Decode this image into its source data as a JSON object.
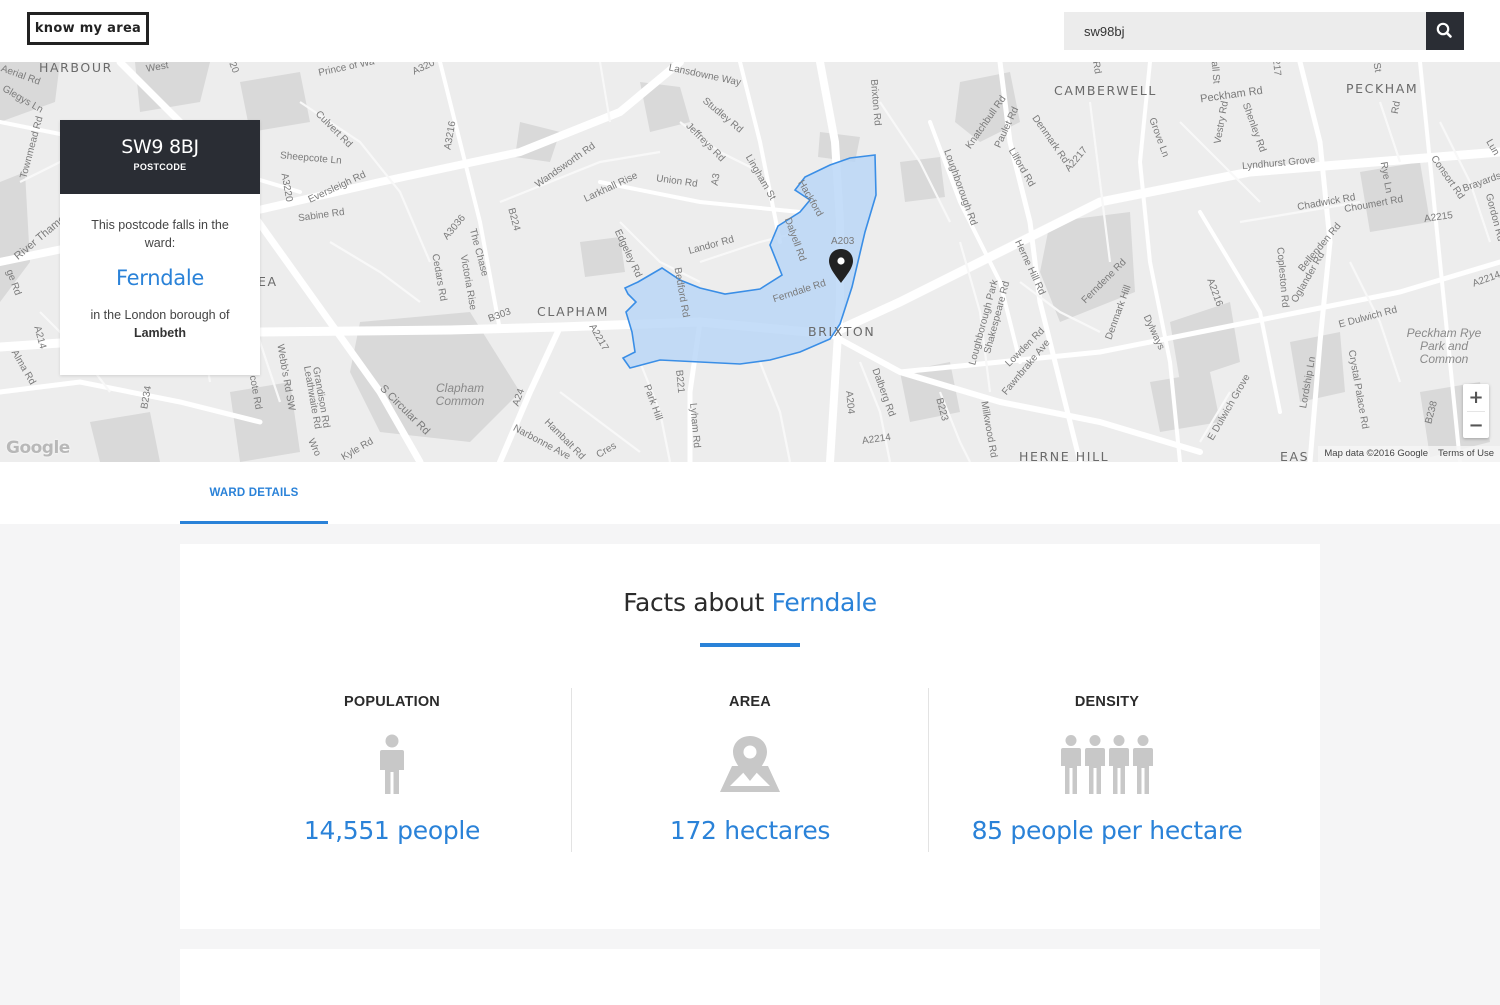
{
  "header": {
    "logo": "know my area",
    "search_value": "sw98bj",
    "search_icon": "search-icon"
  },
  "map": {
    "postcode": "SW9 8BJ",
    "postcode_label": "POSTCODE",
    "falls_in_text": "This postcode falls in the ward:",
    "ward": "Ferndale",
    "borough_text": "in the London borough of",
    "borough": "Lambeth",
    "zoom_in": "+",
    "zoom_out": "−",
    "google": "Google",
    "attribution": "Map data ©2016 Google",
    "terms": "Terms of Use",
    "pin_icon": "map-pin-icon",
    "ward_fill": "#b6d4f6",
    "ward_stroke": "#3a8ee6",
    "area_labels": [
      "HARBOUR",
      "CLAPHAM",
      "BRIXTON",
      "CAMBERWELL",
      "PECKHAM",
      "HERNE HILL",
      "EA",
      "EAS"
    ],
    "park_labels": [
      "Clapham Common",
      "Peckham Rye Park and Common"
    ],
    "road_labels": [
      "Lansdowne Way",
      "Prince of Wa",
      "A320",
      "A3216",
      "Culvert Rd",
      "Sheepcote Ln",
      "Wandsworth Rd",
      "Studley Rd",
      "Jeffreys Rd",
      "Brixton Rd",
      "Union Rd",
      "Larkhall Rise",
      "Lingham St",
      "A3",
      "Dalyell Rd",
      "Landor Rd",
      "A203",
      "Ferndale Rd",
      "Bedford Rd",
      "Edgeley Rd",
      "A2217",
      "B303",
      "A3036",
      "B224",
      "The Chase",
      "Victoria Rise",
      "Cedars Rd",
      "A3220",
      "Eversleigh Rd",
      "Sabine Rd",
      "River Thames",
      "A214",
      "Webb's Rd SW",
      "Grandison Rd",
      "Leathwaite Rd",
      "S Circular Rd",
      "A24",
      "Park Hill",
      "B221",
      "Lyham Rd",
      "Hambalt Rd",
      "Narbonne Ave",
      "Kyle Rd",
      "B234",
      "A204",
      "Dalberg Rd",
      "A2214",
      "B223",
      "Milkwood Rd",
      "Loughborough Rd",
      "Loughborough Park",
      "Shakespeare Rd",
      "Herne Hill Rd",
      "Lowden Rd",
      "Fawnbrake Ave",
      "Ferndene Rd",
      "Denmark Hill",
      "Dylways",
      "A2216",
      "E Dulwich Grove",
      "Lordship Ln",
      "Crystal Palace Rd",
      "B238",
      "E Dulwich Rd",
      "Copleston Rd",
      "Oglander Rd",
      "Bellenden Rd",
      "Chadwick Rd",
      "Choumert Rd",
      "A2215",
      "Lyndhurst Grove",
      "Peckham Rd",
      "Vestry Rd",
      "Shenley Rd",
      "Consort Rd",
      "Brayards",
      "Gordon Rd",
      "Rye Ln",
      "Grove Ln",
      "Denmark Rd",
      "Knatchbull Rd",
      "Paulet Rd",
      "Lilford Rd",
      "A2217",
      "Hackford",
      "Townmead Rd",
      "Glegys Ln",
      "Aerial Rd",
      "Alma Rd",
      "Wro",
      "Cres",
      "A2214",
      "Rd",
      "ge Rd",
      "cote Rd",
      "Lun",
      "all St",
      "Rd",
      "St",
      "217",
      "20",
      "West"
    ]
  },
  "tabs": [
    {
      "label": "WARD DETAILS",
      "active": true
    }
  ],
  "facts": {
    "title_prefix": "Facts about",
    "title_ward": "Ferndale",
    "stats": [
      {
        "label": "POPULATION",
        "icon": "person-icon",
        "value": "14,551 people"
      },
      {
        "label": "AREA",
        "icon": "map-location-icon",
        "value": "172 hectares"
      },
      {
        "label": "DENSITY",
        "icon": "people-group-icon",
        "value": "85 people per hectare"
      }
    ],
    "accent": "#2a82d8",
    "icon_color": "#c8c8c8"
  }
}
